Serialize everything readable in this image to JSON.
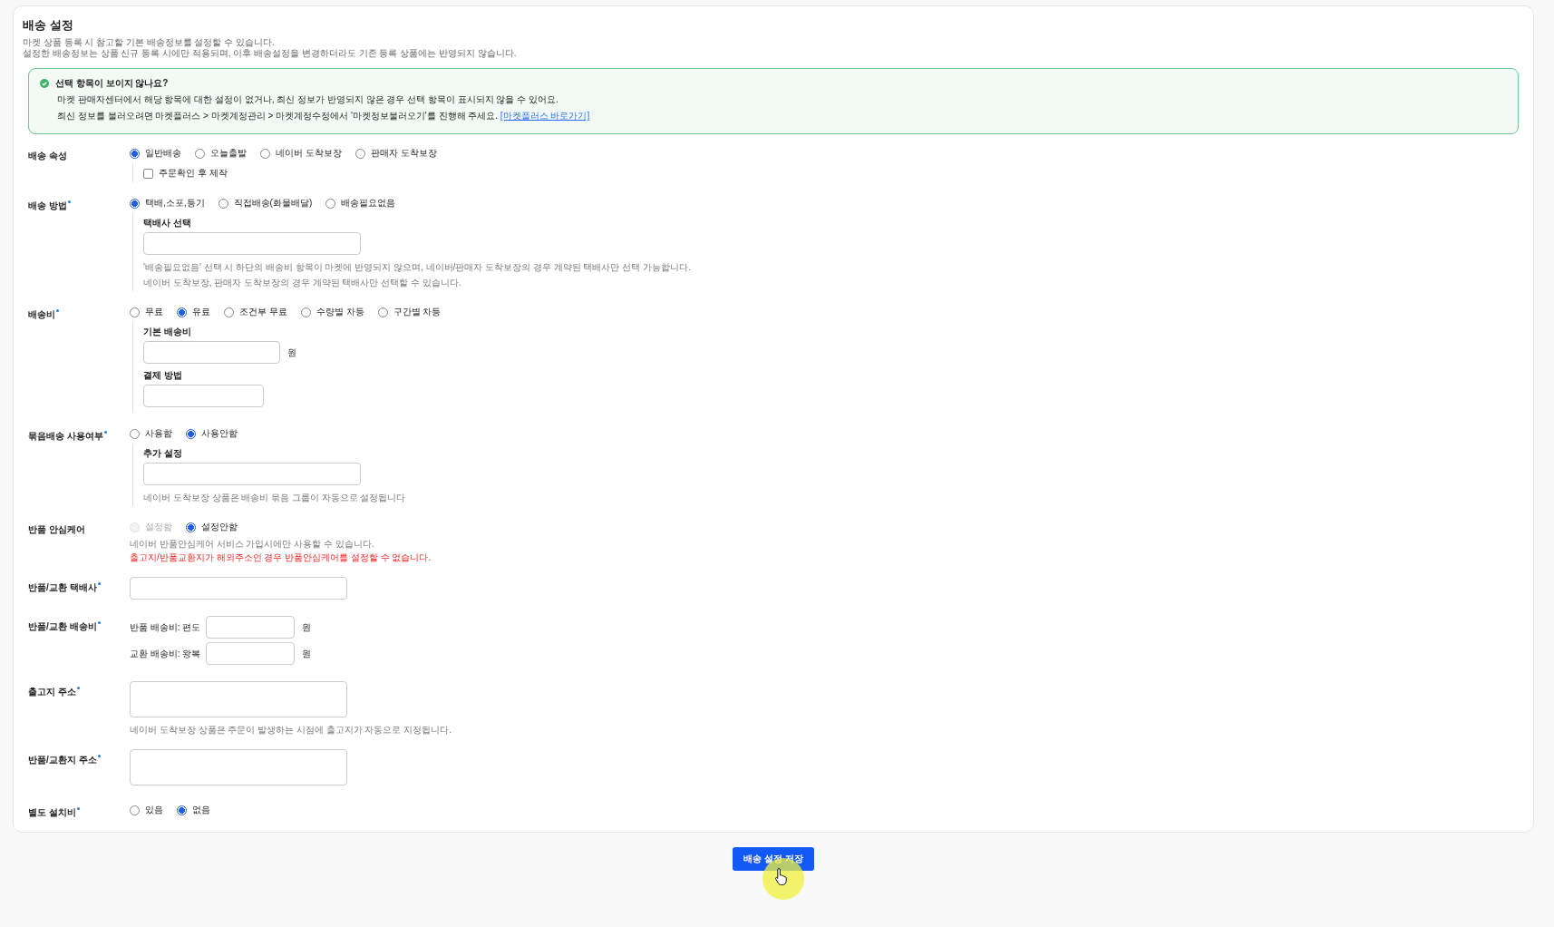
{
  "title": "배송 설정",
  "description": [
    "마켓 상품 등록 시 참고할 기본 배송정보를 설정할 수 있습니다.",
    "설정한 배송정보는 상품 신규 등록 시에만 적용되며, 이후 배송설정을 변경하더라도 기존 등록 상품에는 반영되지 않습니다."
  ],
  "notice": {
    "heading": "선택 항목이 보이지 않나요?",
    "lines": [
      "마켓 판매자센터에서 해당 항목에 대한 설정이 없거나, 최신 정보가 반영되지 않은 경우 선택 항목이 표시되지 않을 수 있어요.",
      "최신 정보를 불러오려면 마켓플러스 > 마켓계정관리 > 마켓계정수정에서 '마켓정보불러오기'를 진행해 주세요."
    ],
    "link": "[마켓플러스 바로가기]"
  },
  "fields": [
    {
      "label": "배송 속성",
      "required": false,
      "options": [
        {
          "label": "일반배송",
          "selected": true,
          "disabled": false
        },
        {
          "label": "오늘출발",
          "selected": false,
          "disabled": false
        },
        {
          "label": "네이버 도착보장",
          "selected": false,
          "disabled": false
        },
        {
          "label": "판매자 도착보장",
          "selected": false,
          "disabled": false
        }
      ],
      "blocks": [
        {
          "kind": "panel",
          "items": [
            {
              "kind": "checkbox",
              "label": "주문확인 후 제작",
              "checked": false
            }
          ]
        }
      ]
    },
    {
      "label": "배송 방법",
      "required": true,
      "options": [
        {
          "label": "택배,소포,등기",
          "selected": true,
          "disabled": false
        },
        {
          "label": "직접배송(화물배달)",
          "selected": false,
          "disabled": false
        },
        {
          "label": "배송필요없음",
          "selected": false,
          "disabled": false
        }
      ],
      "blocks": [
        {
          "kind": "panel",
          "items": [
            {
              "kind": "field-label",
              "text": "택배사 선택"
            },
            {
              "kind": "wide-input"
            },
            {
              "kind": "note",
              "warning": false,
              "text": "'배송필요없음' 선택 시 하단의 배송비 항목이 마켓에 반영되지 않으며, 네이버/판매자 도착보장의 경우 계약된 택배사만 선택 가능합니다."
            },
            {
              "kind": "note",
              "warning": false,
              "text": "네이버 도착보장, 판매자 도착보장의 경우 계약된 택배사만 선택할 수 있습니다."
            }
          ]
        }
      ]
    },
    {
      "label": "배송비",
      "required": true,
      "options": [
        {
          "label": "무료",
          "selected": false,
          "disabled": false
        },
        {
          "label": "유료",
          "selected": true,
          "disabled": false
        },
        {
          "label": "조건부 무료",
          "selected": false,
          "disabled": false
        },
        {
          "label": "수량별 차등",
          "selected": false,
          "disabled": false
        },
        {
          "label": "구간별 차등",
          "selected": false,
          "disabled": false
        }
      ],
      "blocks": [
        {
          "kind": "panel",
          "items": [
            {
              "kind": "field-label",
              "text": "기본 배송비"
            },
            {
              "kind": "short-input",
              "unit": "원"
            },
            {
              "kind": "field-label",
              "text": "결제 방법"
            },
            {
              "kind": "narrow-input"
            }
          ]
        }
      ]
    },
    {
      "label": "묶음배송 사용여부",
      "required": true,
      "options": [
        {
          "label": "사용함",
          "selected": false,
          "disabled": false
        },
        {
          "label": "사용안함",
          "selected": true,
          "disabled": false
        }
      ],
      "blocks": [
        {
          "kind": "panel",
          "items": [
            {
              "kind": "field-label",
              "text": "추가 설정"
            },
            {
              "kind": "wide-input"
            },
            {
              "kind": "note",
              "warning": false,
              "text": "네이버 도착보장 상품은 배송비 묶음 그룹이 자동으로 설정됩니다"
            }
          ]
        }
      ]
    },
    {
      "label": "반품 안심케어",
      "required": false,
      "options": [
        {
          "label": "설정함",
          "selected": false,
          "disabled": true
        },
        {
          "label": "설정안함",
          "selected": true,
          "disabled": false
        }
      ],
      "blocks": [
        {
          "kind": "note",
          "warning": false,
          "text": "네이버 반품안심케어 서비스 가입시에만 사용할 수 있습니다."
        },
        {
          "kind": "note",
          "warning": true,
          "text": "출고지/반품교환지가 해외주소인 경우 반품안심케어를 설정할 수 없습니다."
        }
      ]
    },
    {
      "label": "반품/교환 택배사",
      "required": true,
      "blocks": [
        {
          "kind": "wide-input"
        }
      ]
    },
    {
      "label": "반품/교환 배송비",
      "required": true,
      "blocks": [
        {
          "kind": "fee-line",
          "prefix": "반품 배송비: 편도",
          "unit": "원"
        },
        {
          "kind": "fee-line",
          "prefix": "교환 배송비: 왕복",
          "unit": "원"
        }
      ]
    },
    {
      "label": "출고지 주소",
      "required": true,
      "blocks": [
        {
          "kind": "tall-input"
        },
        {
          "kind": "note",
          "warning": false,
          "text": "네이버 도착보장 상품은 주문이 발생하는 시점에 출고지가 자동으로 지정됩니다."
        }
      ]
    },
    {
      "label": "반품/교환지 주소",
      "required": true,
      "blocks": [
        {
          "kind": "tall-input"
        }
      ]
    },
    {
      "label": "별도 설치비",
      "required": true,
      "options": [
        {
          "label": "있음",
          "selected": false,
          "disabled": false
        },
        {
          "label": "없음",
          "selected": true,
          "disabled": false
        }
      ]
    }
  ],
  "save_button": "배송 설정 저장"
}
